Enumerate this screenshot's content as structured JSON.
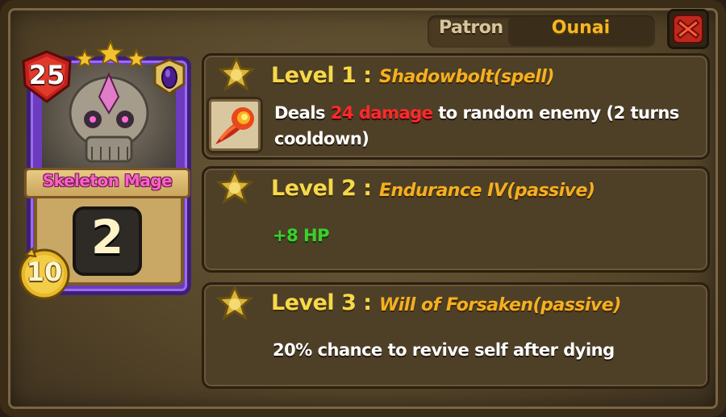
{
  "patron": {
    "label": "Patron",
    "name": "Ounai"
  },
  "card": {
    "name": "Skeleton Mage",
    "level": "25",
    "cost": "2",
    "coins": "10",
    "stars": 3
  },
  "levels": [
    {
      "title": "Level 1 :",
      "ability": "Shadowbolt(spell)",
      "desc_prefix": "Deals ",
      "desc_highlight": "24 damage",
      "desc_suffix_line1": " to random enemy (2 turns",
      "desc_line2": "cooldown)"
    },
    {
      "title": "Level 2 :",
      "ability": "Endurance IV(passive)",
      "desc": "+8 HP"
    },
    {
      "title": "Level 3 :",
      "ability": "Will of Forsaken(passive)",
      "desc": "20% chance to revive self after dying"
    }
  ],
  "colors": {
    "card_frame": "#6c3bc0",
    "title_yellow": "#f6d84a",
    "ability_orange": "#f5b020",
    "damage_red": "#ff2a2a",
    "hp_green": "#3ccf2c",
    "patron_gold": "#f5b722"
  },
  "icons": {
    "close": "close-x-icon",
    "level_star": "star-icon",
    "spell": "fireball-icon",
    "card_gem": "purple-gem-icon",
    "level_badge": "red-shield-icon",
    "coin": "gold-coin-icon"
  }
}
